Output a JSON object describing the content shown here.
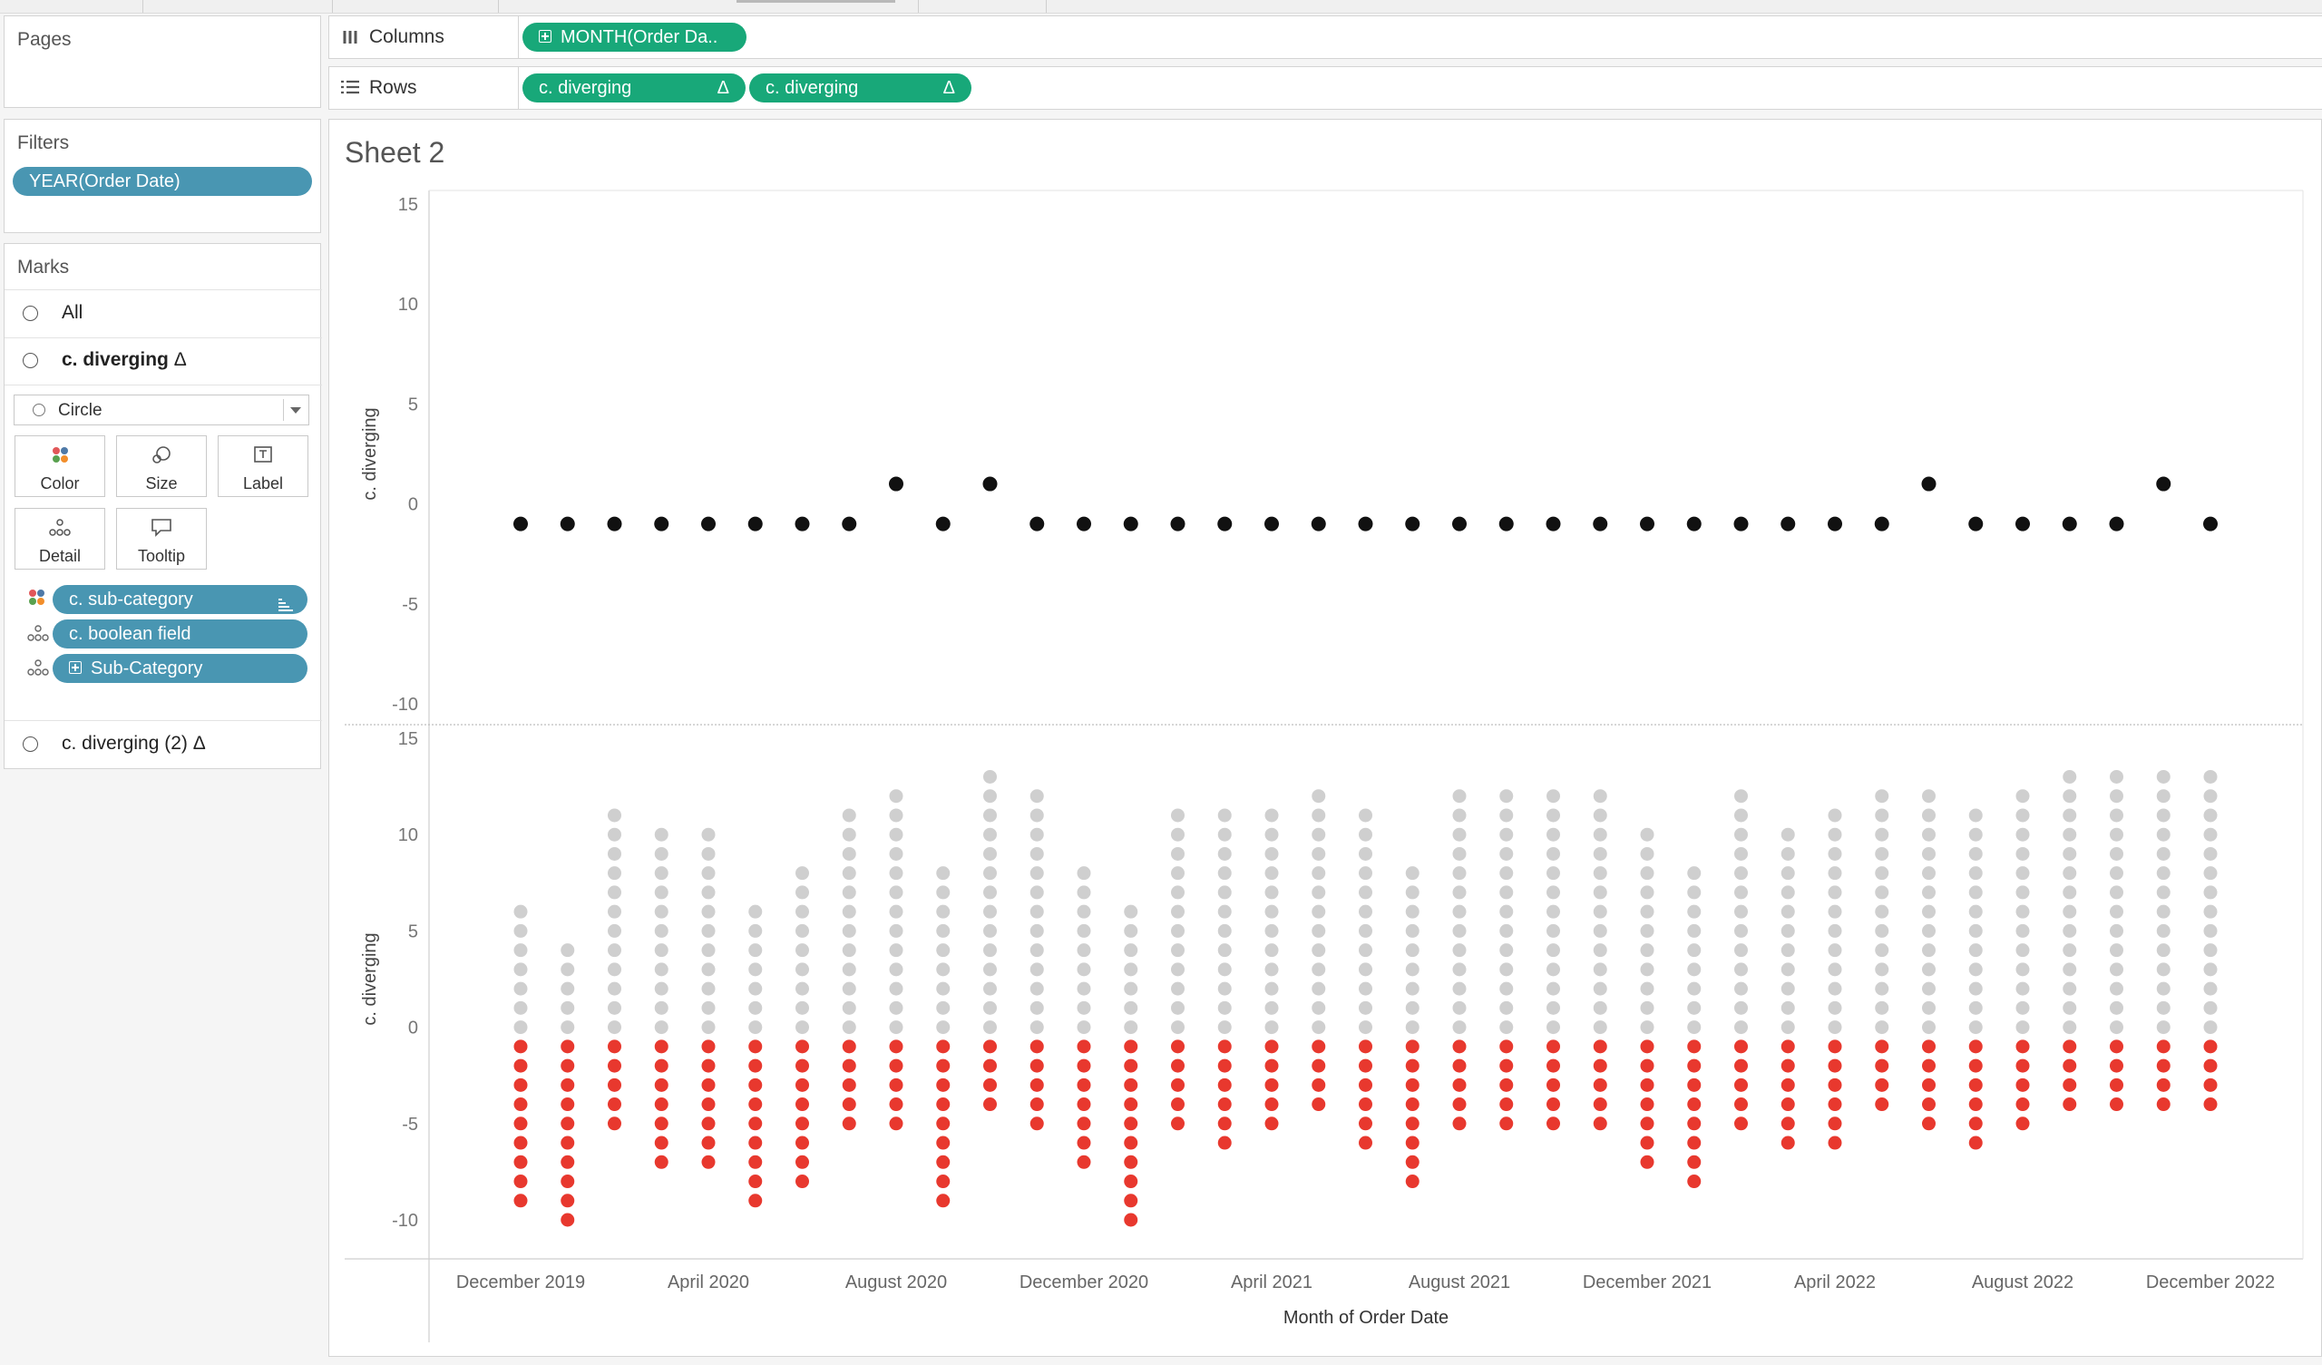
{
  "pages": {
    "title": "Pages"
  },
  "filters": {
    "title": "Filters",
    "pills": [
      {
        "label": "YEAR(Order Date)"
      }
    ]
  },
  "marks": {
    "title": "Marks",
    "all_label": "All",
    "card_1": "c. diverging",
    "mark_type": "Circle",
    "buttons": {
      "color": "Color",
      "size": "Size",
      "label": "Label",
      "detail": "Detail",
      "tooltip": "Tooltip"
    },
    "fields": [
      {
        "name": "c. sub-category",
        "role": "color"
      },
      {
        "name": "c. boolean field",
        "role": "detail"
      },
      {
        "name": "Sub-Category",
        "role": "detail"
      }
    ],
    "card_2": "c. diverging (2)",
    "delta_glyph": "Δ"
  },
  "shelves": {
    "columns_label": "Columns",
    "rows_label": "Rows",
    "columns_pills": [
      "MONTH(Order Da.."
    ],
    "rows_pills": [
      "c. diverging",
      "c. diverging"
    ]
  },
  "sheet": {
    "title": "Sheet 2"
  },
  "colors": {
    "pill_blue": "#4996b2",
    "pill_green": "#18a879",
    "dot_black": "#111111",
    "dot_red": "#e8382e",
    "dot_gray": "#cfcfcf"
  },
  "chart_data": [
    {
      "type": "scatter",
      "ylabel": "c. diverging",
      "ylim": [
        -10,
        15
      ],
      "yticks": [
        15,
        10,
        5,
        0,
        -5,
        -10
      ],
      "months": [
        "2019-12",
        "2020-01",
        "2020-02",
        "2020-03",
        "2020-04",
        "2020-05",
        "2020-06",
        "2020-07",
        "2020-08",
        "2020-09",
        "2020-10",
        "2020-11",
        "2020-12",
        "2021-01",
        "2021-02",
        "2021-03",
        "2021-04",
        "2021-05",
        "2021-06",
        "2021-07",
        "2021-08",
        "2021-09",
        "2021-10",
        "2021-11",
        "2021-12",
        "2022-01",
        "2022-02",
        "2022-03",
        "2022-04",
        "2022-05",
        "2022-06",
        "2022-07",
        "2022-08",
        "2022-09",
        "2022-10",
        "2022-11",
        "2022-12"
      ],
      "values": [
        -1,
        -1,
        -1,
        -1,
        -1,
        -1,
        -1,
        -1,
        1,
        -1,
        1,
        -1,
        -1,
        -1,
        -1,
        -1,
        -1,
        -1,
        -1,
        -1,
        -1,
        -1,
        -1,
        -1,
        -1,
        -1,
        -1,
        -1,
        -1,
        -1,
        1,
        -1,
        -1,
        -1,
        -1,
        1,
        -1
      ]
    },
    {
      "type": "scatter",
      "ylabel": "c. diverging",
      "xlabel": "Month of Order Date",
      "ylim": [
        -10,
        15
      ],
      "yticks": [
        15,
        10,
        5,
        0,
        -5,
        -10
      ],
      "xtick_labels": [
        "December 2019",
        "April 2020",
        "August 2020",
        "December 2020",
        "April 2021",
        "August 2021",
        "December 2021",
        "April 2022",
        "August 2022",
        "December 2022"
      ],
      "months": [
        "2019-12",
        "2020-01",
        "2020-02",
        "2020-03",
        "2020-04",
        "2020-05",
        "2020-06",
        "2020-07",
        "2020-08",
        "2020-09",
        "2020-10",
        "2020-11",
        "2020-12",
        "2021-01",
        "2021-02",
        "2021-03",
        "2021-04",
        "2021-05",
        "2021-06",
        "2021-07",
        "2021-08",
        "2021-09",
        "2021-10",
        "2021-11",
        "2021-12",
        "2022-01",
        "2022-02",
        "2022-03",
        "2022-04",
        "2022-05",
        "2022-06",
        "2022-07",
        "2022-08",
        "2022-09",
        "2022-10",
        "2022-11",
        "2022-12"
      ],
      "series": [
        {
          "name": "positive",
          "values": [
            6,
            4,
            11,
            10,
            10,
            6,
            8,
            11,
            12,
            8,
            13,
            12,
            8,
            6,
            11,
            11,
            11,
            12,
            11,
            8,
            12,
            12,
            12,
            12,
            10,
            8,
            12,
            10,
            11,
            12,
            12,
            11,
            12,
            13,
            13,
            13,
            13
          ]
        },
        {
          "name": "negative",
          "values": [
            -9,
            -10,
            -5,
            -7,
            -7,
            -9,
            -8,
            -5,
            -5,
            -9,
            -4,
            -5,
            -7,
            -10,
            -5,
            -6,
            -5,
            -4,
            -6,
            -8,
            -5,
            -5,
            -5,
            -5,
            -7,
            -8,
            -5,
            -6,
            -6,
            -4,
            -5,
            -6,
            -5,
            -4,
            -4,
            -4,
            -4
          ]
        }
      ]
    }
  ]
}
